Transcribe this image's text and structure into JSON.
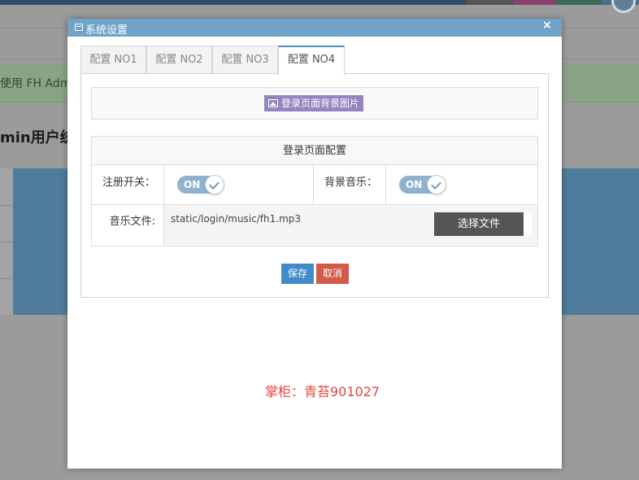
{
  "background": {
    "alert_text": "使用 FH Admi",
    "heading": "min用户统"
  },
  "modal": {
    "title": "系统设置",
    "close_icon": "×",
    "tabs": [
      {
        "label": "配置 NO1",
        "active": false
      },
      {
        "label": "配置 NO2",
        "active": false
      },
      {
        "label": "配置 NO3",
        "active": false
      },
      {
        "label": "配置 NO4",
        "active": true
      }
    ],
    "bg_image_button": "登录页面背景图片",
    "login_config": {
      "title": "登录页面配置",
      "register_label": "注册开关：",
      "register_toggle": "ON",
      "music_label": "背景音乐：",
      "music_toggle": "ON",
      "music_file_label": "音乐文件:",
      "music_file_value": "static/login/music/fh1.mp3",
      "choose_file_button": "选择文件"
    },
    "save_button": "保存",
    "cancel_button": "取消",
    "watermark": "掌柜：青苔901027"
  },
  "colors": {
    "header": "#6fa3c8",
    "save": "#428bca",
    "cancel": "#d15b47",
    "bg_image_button": "#9585bf",
    "toggle_on": "#8fb3cf",
    "watermark": "#e8433e"
  }
}
